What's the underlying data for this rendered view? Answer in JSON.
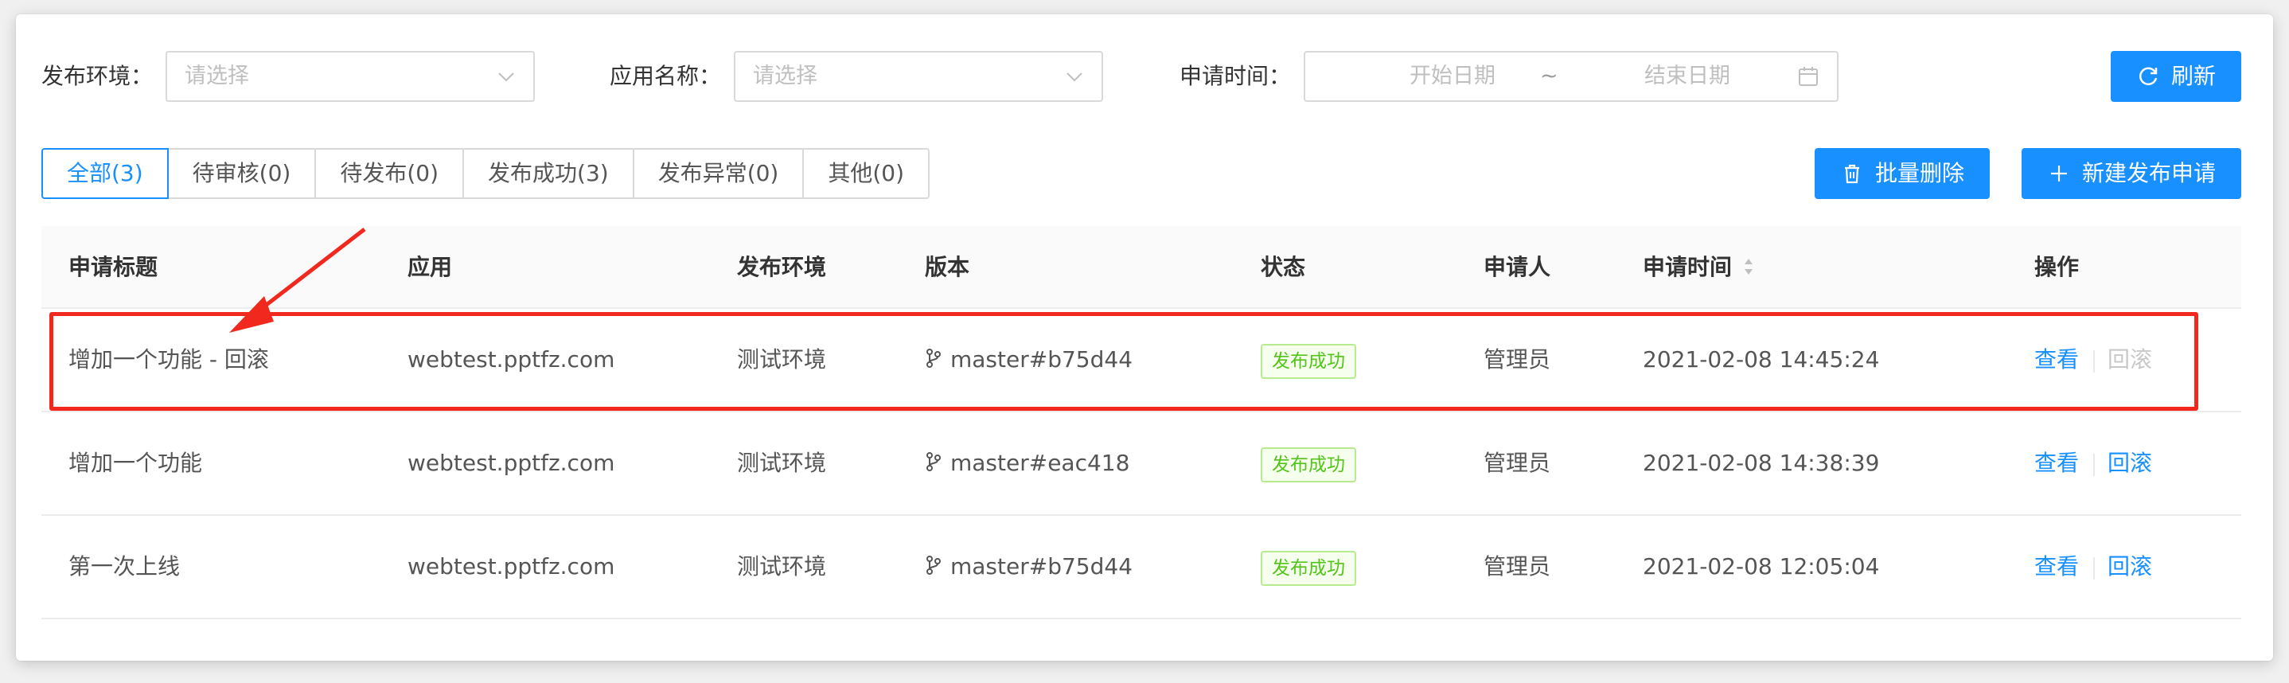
{
  "filters": {
    "env_label": "发布环境：",
    "env_placeholder": "请选择",
    "app_label": "应用名称：",
    "app_placeholder": "请选择",
    "time_label": "申请时间：",
    "start_placeholder": "开始日期",
    "range_separator": "~",
    "end_placeholder": "结束日期",
    "refresh_label": "刷新"
  },
  "tabs": [
    {
      "label": "全部(3)",
      "active": true
    },
    {
      "label": "待审核(0)"
    },
    {
      "label": "待发布(0)"
    },
    {
      "label": "发布成功(3)"
    },
    {
      "label": "发布异常(0)"
    },
    {
      "label": "其他(0)"
    }
  ],
  "actions": {
    "batch_delete_label": "批量删除",
    "new_request_label": "新建发布申请"
  },
  "table": {
    "columns": [
      "申请标题",
      "应用",
      "发布环境",
      "版本",
      "状态",
      "申请人",
      "申请时间",
      "操作"
    ],
    "rows": [
      {
        "title": "增加一个功能 - 回滚",
        "app": "webtest.pptfz.com",
        "env": "测试环境",
        "version": "master#b75d44",
        "status": "发布成功",
        "applicant": "管理员",
        "time": "2021-02-08 14:45:24",
        "view": "查看",
        "rollback": "回滚",
        "rollback_enabled": false
      },
      {
        "title": "增加一个功能",
        "app": "webtest.pptfz.com",
        "env": "测试环境",
        "version": "master#eac418",
        "status": "发布成功",
        "applicant": "管理员",
        "time": "2021-02-08 14:38:39",
        "view": "查看",
        "rollback": "回滚",
        "rollback_enabled": true
      },
      {
        "title": "第一次上线",
        "app": "webtest.pptfz.com",
        "env": "测试环境",
        "version": "master#b75d44",
        "status": "发布成功",
        "applicant": "管理员",
        "time": "2021-02-08 12:05:04",
        "view": "查看",
        "rollback": "回滚",
        "rollback_enabled": true
      }
    ]
  },
  "colors": {
    "primary": "#1890ff",
    "success": "#52c41a",
    "annotation": "#f0281e"
  }
}
